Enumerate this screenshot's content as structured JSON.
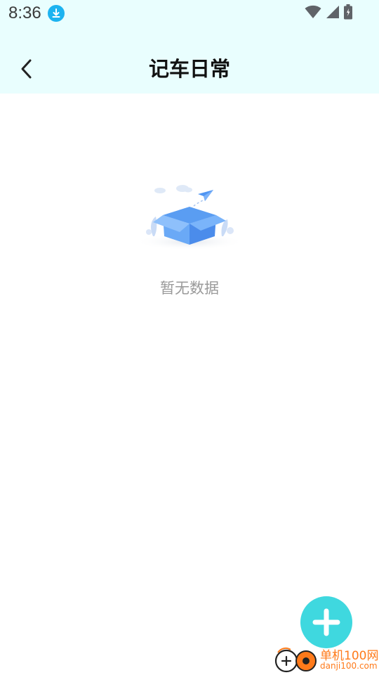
{
  "status_bar": {
    "time": "8:36",
    "icons": [
      "download-icon",
      "wifi-icon",
      "signal-icon",
      "battery-icon"
    ]
  },
  "header": {
    "title": "记车日常",
    "back_icon": "chevron-left-icon"
  },
  "empty_state": {
    "illustration": "empty-box-icon",
    "text": "暂无数据"
  },
  "fab": {
    "icon": "plus-icon",
    "color": "#3fd8df"
  },
  "watermark": {
    "line1": "单机100网",
    "line2": "danji100.com",
    "color": "#ff7a1a"
  },
  "colors": {
    "header_bg": "#e9fefe",
    "title": "#111111",
    "empty_text": "#9a9a9a"
  }
}
